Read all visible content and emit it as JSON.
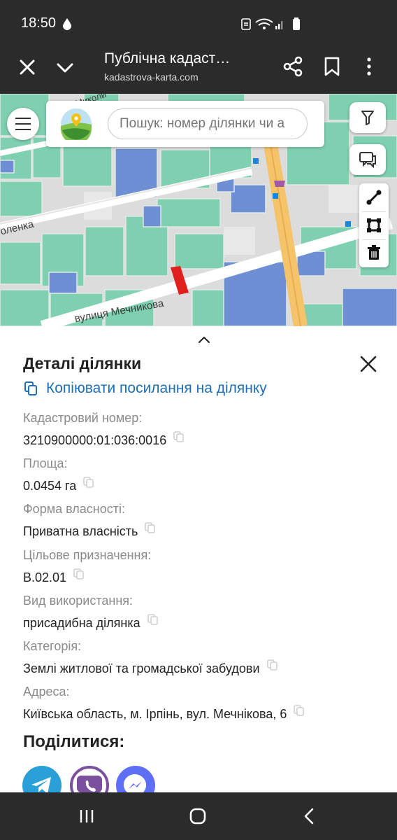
{
  "status_bar": {
    "time": "18:50"
  },
  "browser": {
    "page_title": "Публічна кадаст…",
    "url": "kadastrova-karta.com",
    "icons": [
      "close-icon",
      "chevron-down-icon",
      "share-icon",
      "bookmark-icon",
      "more-vert-icon"
    ]
  },
  "map": {
    "search_placeholder": "Пошук: номер ділянки чи а",
    "street_labels": {
      "top": "вул. Миколи",
      "left": "оленка",
      "bottom": "вулиця Мечникова"
    },
    "colors": {
      "parcel_green": "#7fd0b0",
      "parcel_blue": "#6f8fd4",
      "road_yellow": "#f5c36a",
      "selected_parcel": "#e0201c"
    },
    "tools": [
      "filter-icon",
      "comment-icon",
      "line-icon",
      "polygon-icon",
      "trash-icon"
    ]
  },
  "details": {
    "title": "Деталі ділянки",
    "copy_link_label": "Копіювати посилання на ділянку",
    "fields": [
      {
        "label": "Кадастровий номер:",
        "value": "3210900000:01:036:0016"
      },
      {
        "label": "Площа:",
        "value": "0.0454 га"
      },
      {
        "label": "Форма власності:",
        "value": "Приватна власність"
      },
      {
        "label": "Цільове призначення:",
        "value": "В.02.01"
      },
      {
        "label": "Вид використання:",
        "value": "присадибна ділянка"
      },
      {
        "label": "Категорія:",
        "value": "Землі житлової та громадської забудови"
      },
      {
        "label": "Адреса:",
        "value": "Київська область, м. Ірпінь, вул. Мечнікова, 6"
      }
    ],
    "share_title": "Поділитися:",
    "share_targets": [
      "telegram-icon",
      "viber-icon",
      "messenger-icon"
    ],
    "link_color": "#1e6fb8"
  }
}
